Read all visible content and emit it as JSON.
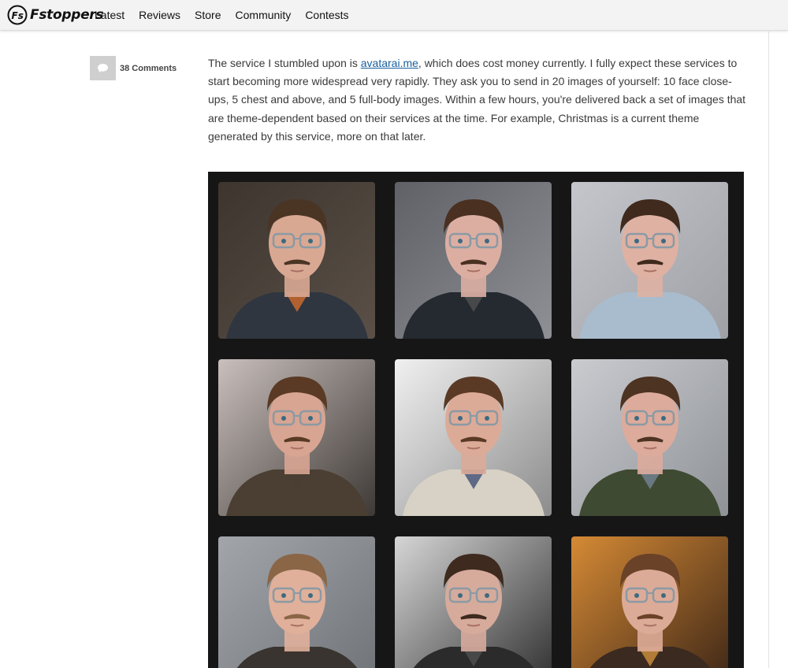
{
  "nav": {
    "logo_text": "Fstoppers",
    "items": [
      {
        "label": "Latest"
      },
      {
        "label": "Reviews"
      },
      {
        "label": "Store"
      },
      {
        "label": "Community"
      },
      {
        "label": "Contests"
      }
    ]
  },
  "comments": {
    "count_label": "38 Comments",
    "icon": "speech-bubble-icon"
  },
  "article": {
    "text_before": "The service I stumbled upon is ",
    "link_text": "avatarai.me",
    "text_after": ", which does cost money currently. I fully expect these services to start becoming more widespread very rapidly. They ask you to send in 20 images of yourself: 10 face close-ups, 5 chest and above, and 5 full-body images. Within a few hours, you're delivered back a set of images that are theme-dependent based on their services at the time. For example, Christmas is a current theme generated by this service, more on that later."
  },
  "colors": {
    "link": "#1a5f9e",
    "nav_bg": "#f3f3f3",
    "grid_bg": "#161616",
    "comment_box": "#cfcfcf"
  },
  "grid": {
    "columns": 3,
    "visible_rows": 3,
    "tiles": [
      {
        "bg": "#5a5048",
        "bg2": "#3d352e",
        "skin": "#d9a893",
        "hair": "#4a3525",
        "cloth": "#2f3640",
        "accent": "#e8742a"
      },
      {
        "bg": "#8e9096",
        "bg2": "#5f6167",
        "skin": "#dcaea2",
        "hair": "#4a3021",
        "cloth": "#252a30",
        "accent": "#555"
      },
      {
        "bg": "#9ea0a6",
        "bg2": "#c4c6cb",
        "skin": "#dfb1a3",
        "hair": "#3f2a1d",
        "cloth": "#a9bccd",
        "accent": "#a9bccd"
      },
      {
        "bg": "#3e3936",
        "bg2": "#c9bfbc",
        "skin": "#d8a592",
        "hair": "#5a3a24",
        "cloth": "#4a3f32",
        "accent": "#4a3f32"
      },
      {
        "bg": "#8c8c8c",
        "bg2": "#f0f0f0",
        "skin": "#dcab98",
        "hair": "#5a3a25",
        "cloth": "#d8d2c6",
        "accent": "#2c3a6a"
      },
      {
        "bg": "#8f9297",
        "bg2": "#c9cbcf",
        "skin": "#dcab9c",
        "hair": "#4d3322",
        "cloth": "#3f4a32",
        "accent": "#7c8ca3"
      },
      {
        "bg": "#6e7277",
        "bg2": "#a2a6ab",
        "skin": "#e0b09b",
        "hair": "#8a6646",
        "cloth": "#3a3430",
        "accent": "#3a3430"
      },
      {
        "bg": "#2b2b2b",
        "bg2": "#d6d6d6",
        "skin": "#d6ab9c",
        "hair": "#3e2a1e",
        "cloth": "#2b2b2b",
        "accent": "#555"
      },
      {
        "bg": "#3a2416",
        "bg2": "#d58a35",
        "skin": "#dcab98",
        "hair": "#6a4228",
        "cloth": "#3a2a20",
        "accent": "#e6a040"
      }
    ]
  }
}
